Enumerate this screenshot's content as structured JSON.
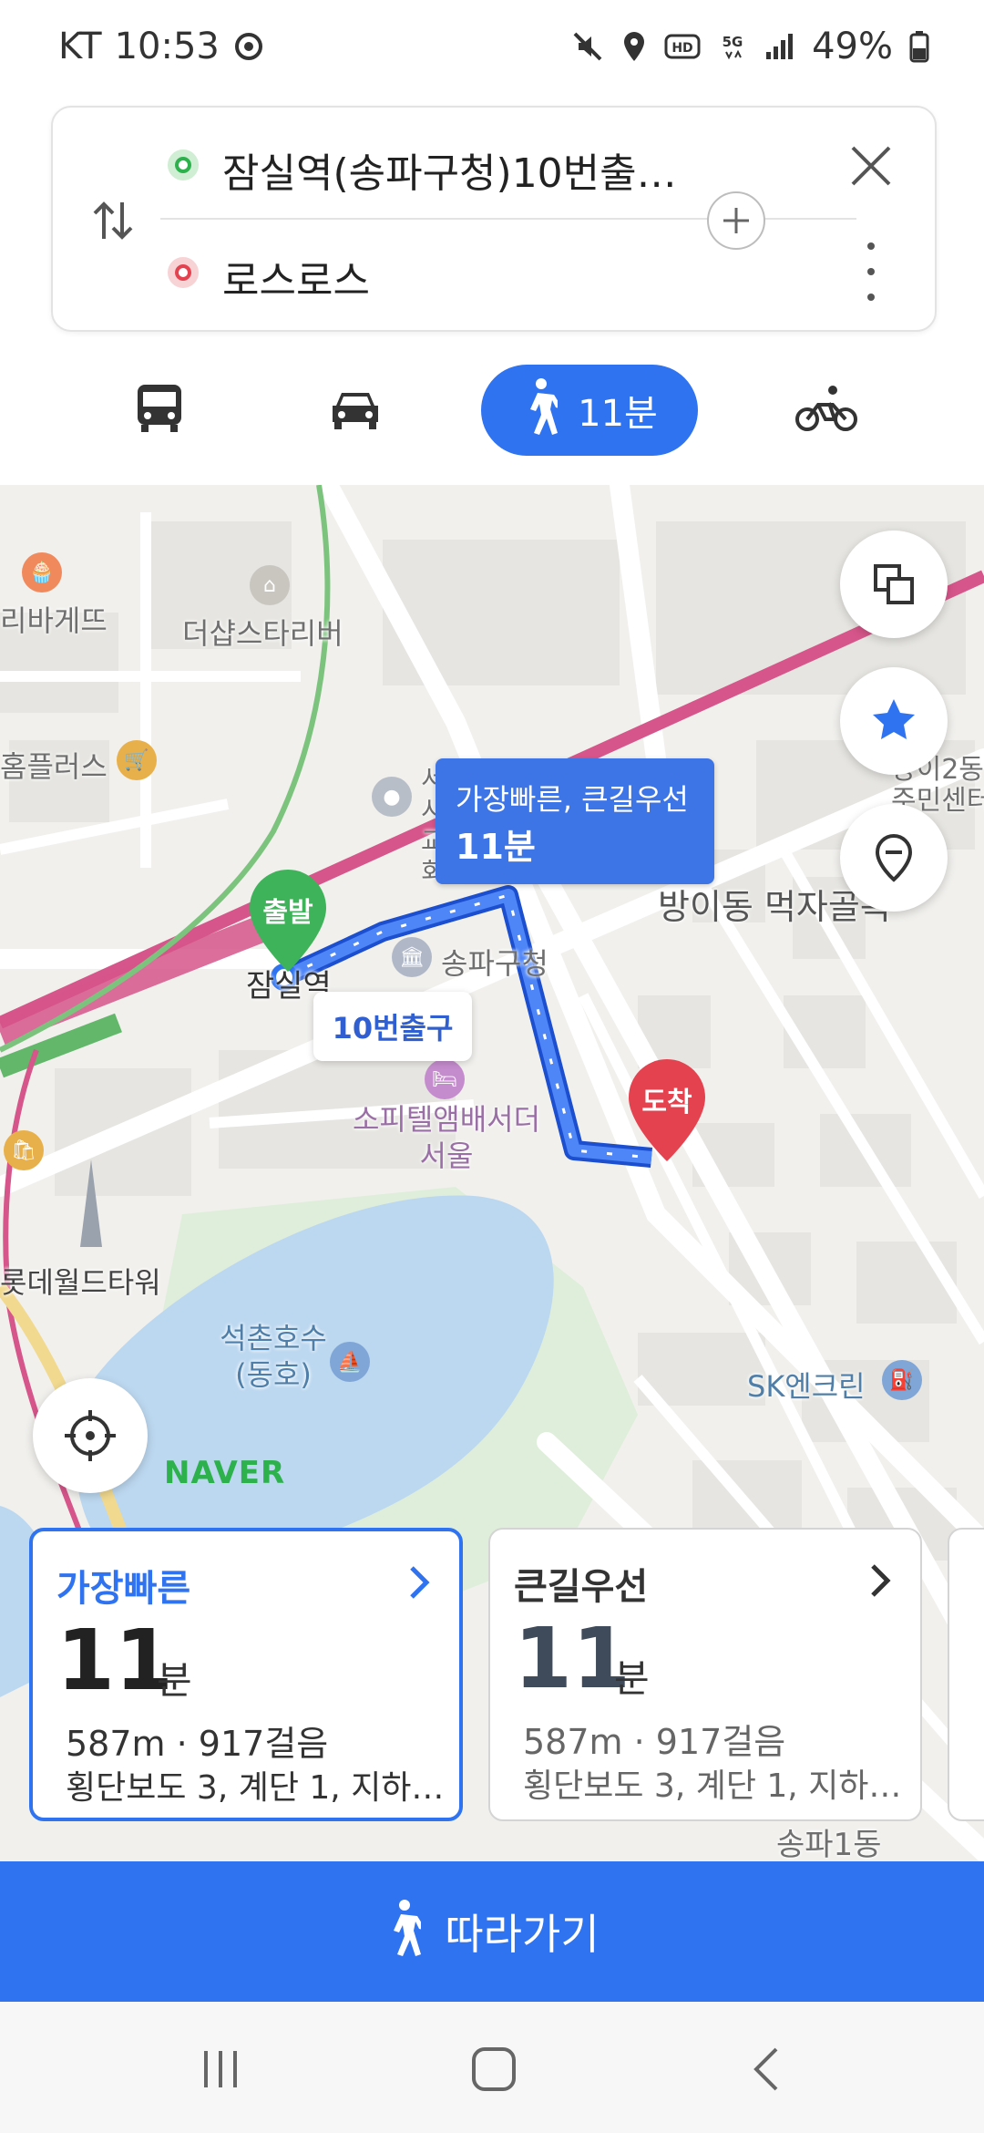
{
  "status_bar": {
    "carrier": "KT",
    "time": "10:53",
    "battery": "49%"
  },
  "route_search": {
    "origin": "잠실역(송파구청)10번출…",
    "destination": "로스로스"
  },
  "modes": {
    "walk_time": "11분",
    "active": "walk"
  },
  "map": {
    "labels": {
      "l1": "리바게뜨",
      "l2": "더샵스타리버",
      "l3": "홈플러스",
      "l4": "서울시 교통회관",
      "l5": "송파구청",
      "l6": "잠실역",
      "l7": "방이동 먹자골목",
      "l8": "소피텔앰배서더 서울",
      "l9": "롯데월드타워",
      "l10": "석촌호수 (동호)",
      "l11": "SK엔크린",
      "l12": "방이2동 주민센터",
      "l13": "송파1동"
    },
    "route_tag": {
      "title": "가장빠른, 큰길우선",
      "time": "11분"
    },
    "exit_tag": "10번출구",
    "start_pin": "출발",
    "end_pin": "도착",
    "logo": "NAVER"
  },
  "route_cards": [
    {
      "name": "가장빠른",
      "minutes": "11",
      "unit": "분",
      "distance": "587m · 917걸음",
      "detail": "횡단보도 3, 계단 1, 지하…"
    },
    {
      "name": "큰길우선",
      "minutes": "11",
      "unit": "분",
      "distance": "587m · 917걸음",
      "detail": "횡단보도 3, 계단 1, 지하…"
    }
  ],
  "follow_button": "따라가기",
  "colors": {
    "accent": "#2f73f0",
    "start": "#2db14d",
    "end": "#e5424f"
  }
}
